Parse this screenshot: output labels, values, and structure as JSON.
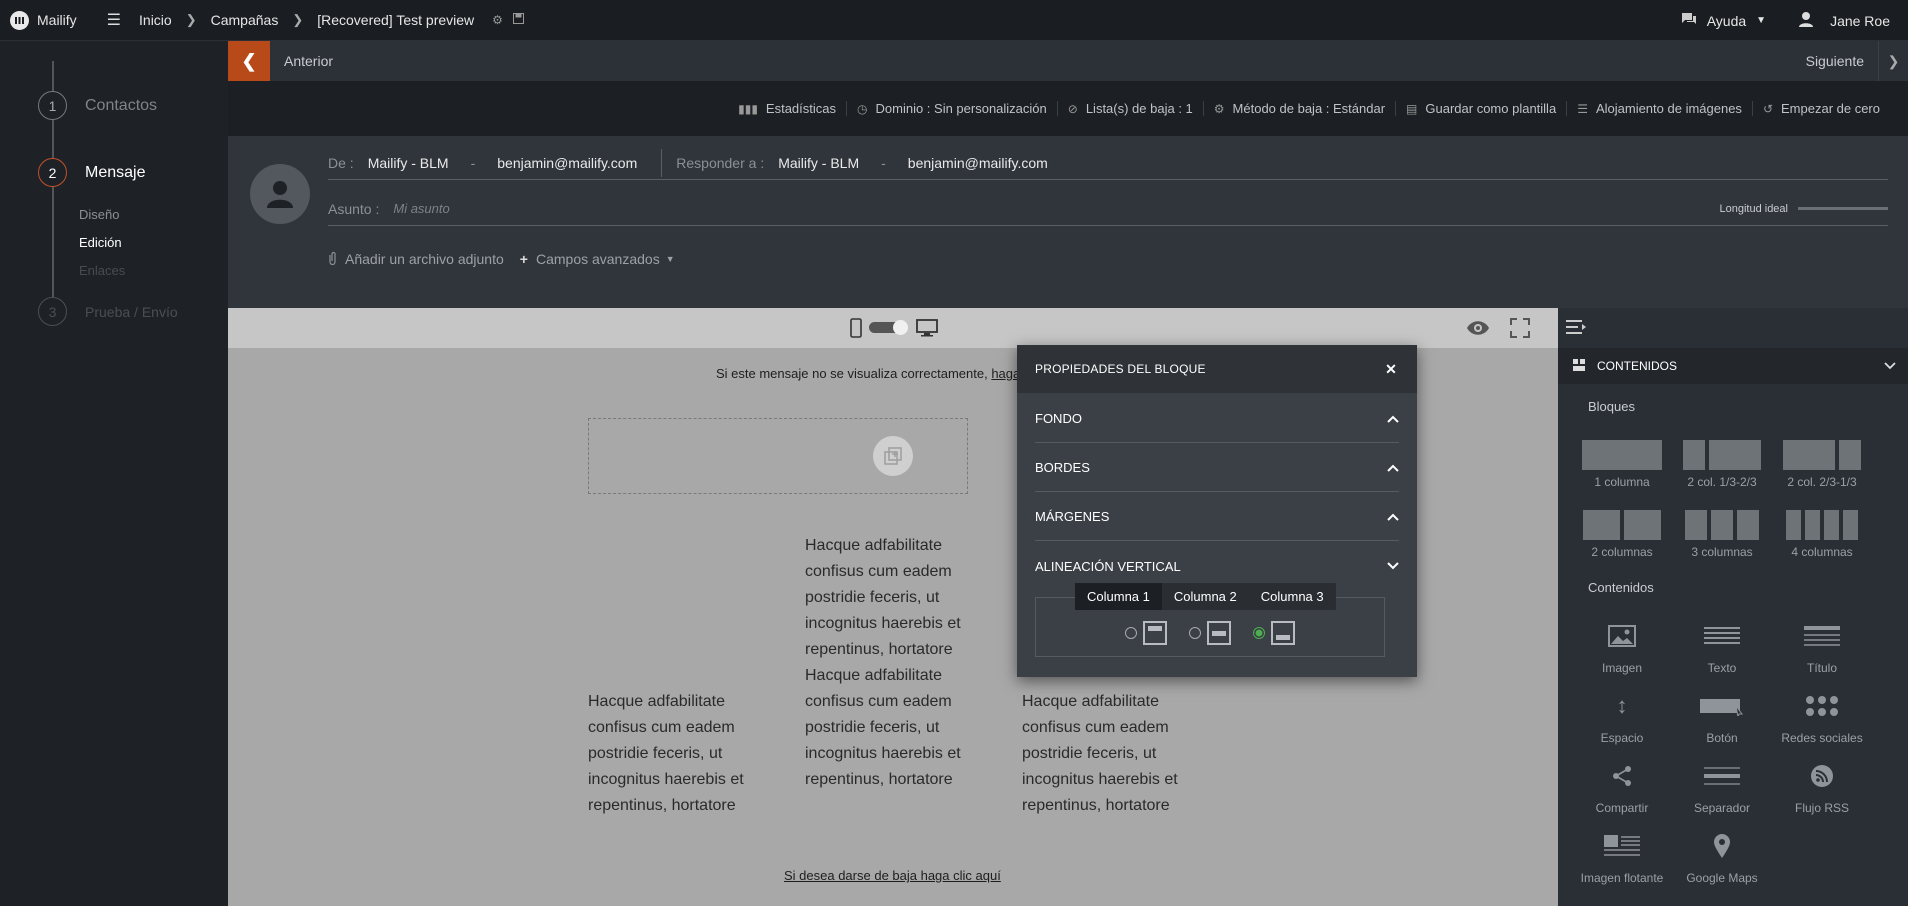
{
  "topbar": {
    "brand": "Mailify",
    "breadcrumb": [
      "Inicio",
      "Campañas",
      "[Recovered] Test preview"
    ],
    "help": "Ayuda",
    "user": "Jane Roe"
  },
  "sidebar": {
    "steps": [
      {
        "num": "1",
        "label": "Contactos"
      },
      {
        "num": "2",
        "label": "Mensaje"
      },
      {
        "num": "3",
        "label": "Prueba / Envío"
      }
    ],
    "subs": [
      "Diseño",
      "Edición",
      "Enlaces"
    ]
  },
  "nav": {
    "prev": "Anterior",
    "next": "Siguiente"
  },
  "tools": [
    "Estadísticas",
    "Dominio : Sin personalización",
    "Lista(s) de baja : 1",
    "Método de baja : Estándar",
    "Guardar como plantilla",
    "Alojamiento de imágenes",
    "Empezar de cero"
  ],
  "header": {
    "from_label": "De :",
    "from_name": "Mailify - BLM",
    "from_email": "benjamin@mailify.com",
    "reply_label": "Responder a :",
    "reply_name": "Mailify - BLM",
    "reply_email": "benjamin@mailify.com",
    "subject_label": "Asunto :",
    "subject_placeholder": "Mi asunto",
    "ideal_length": "Longitud ideal",
    "attach": "Añadir un archivo adjunto",
    "advanced": "Campos avanzados"
  },
  "preview": {
    "notice": "Si este mensaje no se visualiza correctamente,",
    "notice_link": "haga",
    "lorem": "Hacque adfabilitate confisus cum eadem postridie feceris, ut incognitus haerebis et repentinus, hortatore",
    "unsubscribe": "Si desea darse de baja haga clic aquí"
  },
  "modal": {
    "title": "PROPIEDADES DEL BLOQUE",
    "sections": [
      "FONDO",
      "BORDES",
      "MÁRGENES",
      "ALINEACIÓN VERTICAL"
    ],
    "tabs": [
      "Columna 1",
      "Columna 2",
      "Columna 3"
    ],
    "selected_alignment": "bottom"
  },
  "panel": {
    "title": "CONTENIDOS",
    "blocks_label": "Bloques",
    "blocks": [
      "1 columna",
      "2 col. 1/3-2/3",
      "2 col. 2/3-1/3",
      "2 columnas",
      "3 columnas",
      "4 columnas"
    ],
    "contents_label": "Contenidos",
    "contents": [
      "Imagen",
      "Texto",
      "Título",
      "Espacio",
      "Botón",
      "Redes sociales",
      "Compartir",
      "Separador",
      "Flujo RSS",
      "Imagen flotante",
      "Google Maps"
    ]
  }
}
